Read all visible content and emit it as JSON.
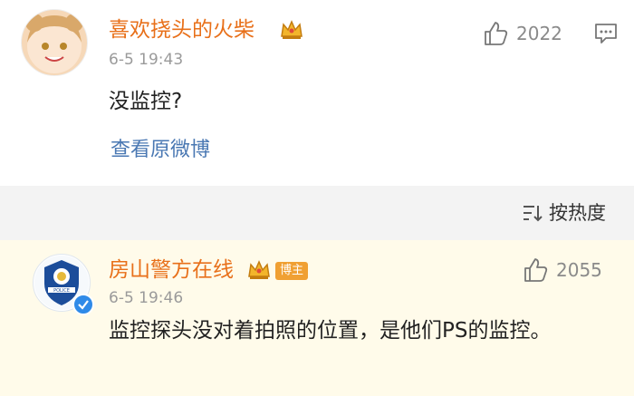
{
  "comment1": {
    "username": "喜欢挠头的火柴",
    "timestamp": "6-5 19:43",
    "text": "没监控?",
    "likes": "2022",
    "view_original": "查看原微博"
  },
  "sort": {
    "label": "按热度"
  },
  "comment2": {
    "username": "房山警方在线",
    "badge": "博主",
    "timestamp": "6-5 19:46",
    "text": "监控探头没对着拍照的位置，是他们PS的监控。",
    "likes": "2055",
    "avatar_label": "FANGSHAN POLICE 房山警方"
  },
  "colors": {
    "username": "#e8701a",
    "link": "#4a78b3",
    "highlight_bg": "#fffbea"
  },
  "icons": [
    "thumbs-up-icon",
    "comment-icon",
    "sort-icon",
    "crown-icon",
    "verified-icon"
  ]
}
